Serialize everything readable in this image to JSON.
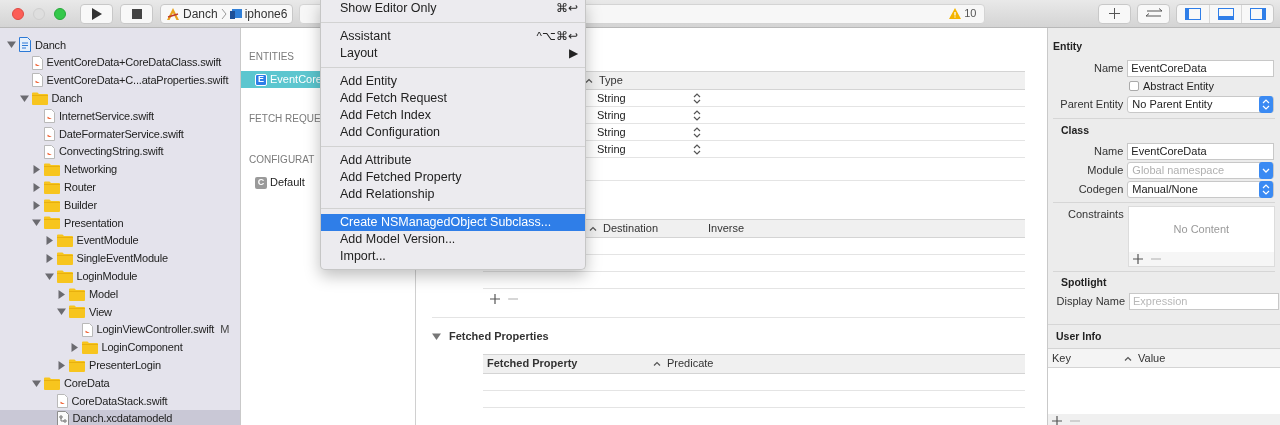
{
  "toolbar": {
    "scheme": "Danch",
    "device": "iphone6",
    "warnings": "10",
    "panels": [
      {
        "kind": "left",
        "on": true
      },
      {
        "kind": "bottom",
        "on": true
      },
      {
        "kind": "right",
        "on": true
      }
    ]
  },
  "navigator": [
    {
      "name": "Danch",
      "kind": "project",
      "expanded": true,
      "selected": false,
      "children": [
        {
          "name": "EventCoreData+CoreDataClass.swift",
          "kind": "file",
          "selected": false
        },
        {
          "name": "EventCoreData+C...ataProperties.swift",
          "kind": "file",
          "selected": false
        },
        {
          "name": "Danch",
          "kind": "folder",
          "expanded": true,
          "selected": false,
          "children": [
            {
              "name": "InternetService.swift",
              "kind": "file",
              "selected": false
            },
            {
              "name": "DateFormaterService.swift",
              "kind": "file",
              "selected": false
            },
            {
              "name": "ConvectingString.swift",
              "kind": "file",
              "selected": false
            },
            {
              "name": "Networking",
              "kind": "folder",
              "expanded": false,
              "selected": false
            },
            {
              "name": "Router",
              "kind": "folder",
              "expanded": false,
              "selected": false
            },
            {
              "name": "Builder",
              "kind": "folder",
              "expanded": false,
              "selected": false
            },
            {
              "name": "Presentation",
              "kind": "folder",
              "expanded": true,
              "selected": false,
              "children": [
                {
                  "name": "EventModule",
                  "kind": "folder",
                  "expanded": false,
                  "selected": false
                },
                {
                  "name": "SingleEventModule",
                  "kind": "folder",
                  "expanded": false,
                  "selected": false
                },
                {
                  "name": "LoginModule",
                  "kind": "folder",
                  "expanded": true,
                  "selected": false,
                  "children": [
                    {
                      "name": "Model",
                      "kind": "folder",
                      "expanded": false,
                      "selected": false
                    },
                    {
                      "name": "View",
                      "kind": "folder",
                      "expanded": true,
                      "selected": false,
                      "children": [
                        {
                          "name": "LoginViewController.swift",
                          "kind": "file",
                          "selected": false,
                          "badge": "M"
                        },
                        {
                          "name": "LoginComponent",
                          "kind": "folder",
                          "expanded": false,
                          "selected": false
                        }
                      ]
                    },
                    {
                      "name": "PresenterLogin",
                      "kind": "folder",
                      "expanded": false,
                      "selected": false
                    }
                  ]
                }
              ]
            },
            {
              "name": "CoreData",
              "kind": "folder",
              "expanded": true,
              "selected": false,
              "children": [
                {
                  "name": "CoreDataStack.swift",
                  "kind": "file",
                  "selected": false
                },
                {
                  "name": "Danch.xcdatamodeld",
                  "kind": "model",
                  "selected": true
                }
              ]
            }
          ]
        }
      ]
    }
  ],
  "outline": [
    {
      "kind": "header",
      "label": "ENTITIES"
    },
    {
      "kind": "entity",
      "badge": "E",
      "label": "EventCore",
      "selected": true
    },
    {
      "kind": "header",
      "label": "FETCH REQUE"
    },
    {
      "kind": "header",
      "label": "CONFIGURAT"
    },
    {
      "kind": "configuration",
      "badge": "C",
      "label": "Default",
      "selected": false
    }
  ],
  "attributes": {
    "type_header": "Type",
    "rows": [
      {
        "type": "String"
      },
      {
        "type": "String"
      },
      {
        "type": "String"
      },
      {
        "type": "String"
      }
    ]
  },
  "relationships": {
    "columns": [
      "Destination",
      "Inverse"
    ]
  },
  "fetched_properties": {
    "title": "Fetched Properties",
    "expanded": true,
    "columns": [
      "Fetched Property",
      "Predicate"
    ]
  },
  "menu": [
    {
      "kind": "item",
      "label": "Show Editor Only",
      "shortcut": "⌘↩",
      "selected": false
    },
    {
      "kind": "separator"
    },
    {
      "kind": "item",
      "label": "Assistant",
      "shortcut": "^⌥⌘↩",
      "selected": false
    },
    {
      "kind": "item",
      "label": "Layout",
      "shortcut": "▶",
      "selected": false
    },
    {
      "kind": "separator"
    },
    {
      "kind": "item",
      "label": "Add Entity",
      "selected": false
    },
    {
      "kind": "item",
      "label": "Add Fetch Request",
      "selected": false
    },
    {
      "kind": "item",
      "label": "Add Fetch Index",
      "selected": false
    },
    {
      "kind": "item",
      "label": "Add Configuration",
      "selected": false
    },
    {
      "kind": "separator"
    },
    {
      "kind": "item",
      "label": "Add Attribute",
      "selected": false
    },
    {
      "kind": "item",
      "label": "Add Fetched Property",
      "selected": false
    },
    {
      "kind": "item",
      "label": "Add Relationship",
      "selected": false
    },
    {
      "kind": "separator"
    },
    {
      "kind": "item",
      "label": "Create NSManagedObject Subclass...",
      "selected": true
    },
    {
      "kind": "item",
      "label": "Add Model Version...",
      "selected": false
    },
    {
      "kind": "item",
      "label": "Import...",
      "selected": false
    }
  ],
  "inspector": {
    "entity": {
      "title": "Entity",
      "name_label": "Name",
      "name": "EventCoreData",
      "abstract_label": "Abstract Entity",
      "abstract": false,
      "parent_label": "Parent Entity",
      "parent": "No Parent Entity"
    },
    "class": {
      "title": "Class",
      "name_label": "Name",
      "name": "EventCoreData",
      "module_label": "Module",
      "module_placeholder": "Global namespace",
      "codegen_label": "Codegen",
      "codegen": "Manual/None",
      "constraints_label": "Constraints",
      "constraints_empty": "No Content"
    },
    "spotlight": {
      "title": "Spotlight",
      "display_label": "Display Name",
      "display_placeholder": "Expression"
    },
    "user_info": {
      "title": "User Info",
      "columns": [
        "Key",
        "Value"
      ]
    }
  }
}
